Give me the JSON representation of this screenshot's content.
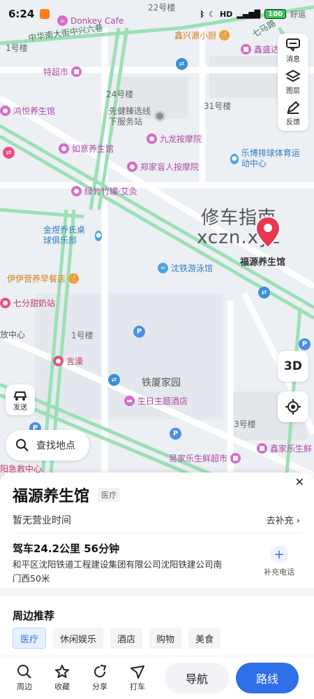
{
  "status_bar": {
    "time": "6:24",
    "network": "HD",
    "battery": "100",
    "extra": "好运"
  },
  "map": {
    "streets": [
      "22号楼",
      "1号楼",
      "24号楼",
      "31号楼",
      "1号楼",
      "3号楼"
    ],
    "road_labels": [
      "中华南大街中兴六巷",
      "七马路"
    ],
    "area_labels": [
      "先健臻选线下服务站",
      "铁厦家园",
      "放中心",
      "阳急救中心"
    ],
    "pois": [
      {
        "name": "Donkey Cafe",
        "style": "pink"
      },
      {
        "name": "鑫兴源小厨",
        "style": "orange"
      },
      {
        "name": "鑫盛达",
        "style": "pink"
      },
      {
        "name": "特超市",
        "style": "pink"
      },
      {
        "name": "鸿悦养生馆",
        "style": "pink"
      },
      {
        "name": "九龙按摩院",
        "style": "pink"
      },
      {
        "name": "如意养生馆",
        "style": "pink"
      },
      {
        "name": "乐博排球体育运动中心",
        "style": "blue"
      },
      {
        "name": "郑家盲人按摩院",
        "style": "pink"
      },
      {
        "name": "绿竹竹罐·艾灸",
        "style": "pink"
      },
      {
        "name": "金煜乔氏桌球俱乐部",
        "style": "blue"
      },
      {
        "name": "沈铁游泳馆",
        "style": "blue"
      },
      {
        "name": "伊伊营养早餐店",
        "style": "orange"
      },
      {
        "name": "七分甜奶站",
        "style": "red"
      },
      {
        "name": "言澡",
        "style": "red"
      },
      {
        "name": "生日主题酒店",
        "style": "pink"
      },
      {
        "name": "易家乐生鲜超市",
        "style": "pink"
      },
      {
        "name": "鑫家乐生鲜",
        "style": "pink"
      }
    ],
    "watermark_line1": "修车指南",
    "watermark_line2": "xczn.xyz",
    "selected_pin_label": "福源养生馆"
  },
  "side_tools": {
    "message": "消息",
    "layers": "图层",
    "feedback": "反馈"
  },
  "btn_3d": "3D",
  "send_label": "发送",
  "search_placeholder": "查找地点",
  "panel": {
    "title": "福源养生馆",
    "tag": "医疗",
    "hours": "暂无营业时间",
    "supplement": "去补充",
    "drive": "驾车24.2公里  56分钟",
    "address": "和平区沈阳铁道工程建设集团有限公司沈阳铁建公司南门西50米",
    "add_phone": "补充电话",
    "nearby_title": "周边推荐",
    "chips": [
      "医疗",
      "休闲娱乐",
      "酒店",
      "购物",
      "美食"
    ]
  },
  "bottom_bar": {
    "nearby": "周边",
    "favorite": "收藏",
    "share": "分享",
    "taxi": "打车",
    "navigate": "导航",
    "route": "路线"
  }
}
